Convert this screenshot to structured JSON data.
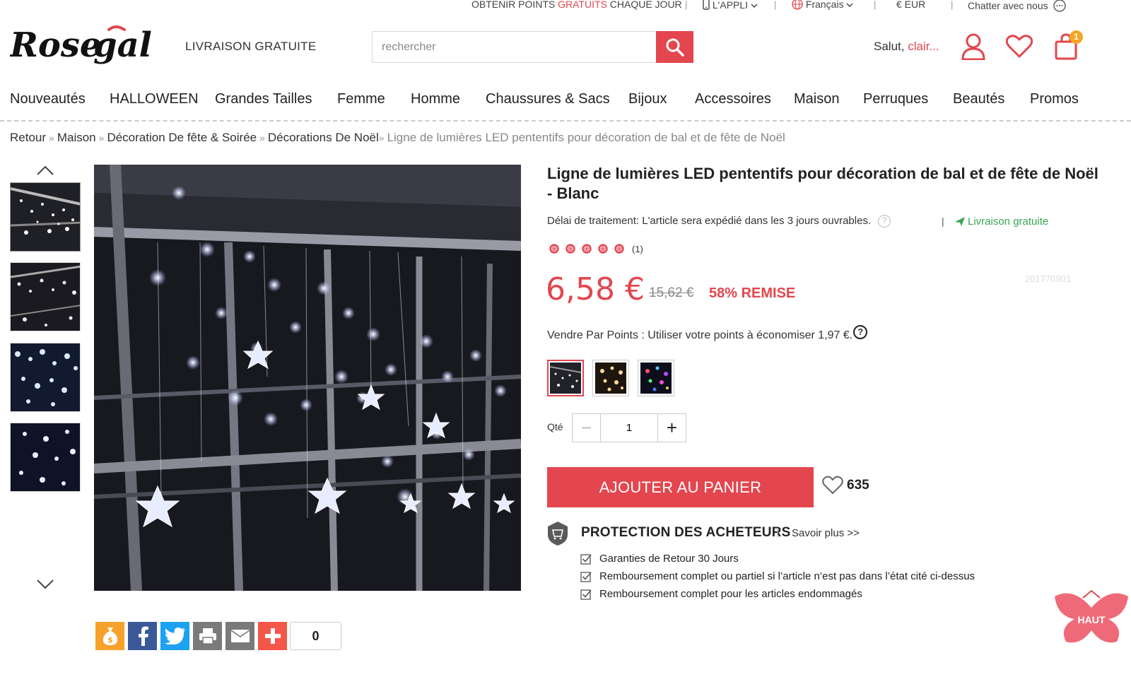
{
  "topbar": {
    "points_pre": "OBTENIR POINTS ",
    "points_red": "GRATUITS",
    "points_post": " CHAQUE JOUR",
    "app": "L'APPLI",
    "language": "Français",
    "currency": "€ EUR",
    "chat": "Chatter avec nous"
  },
  "header": {
    "logo_text": "Rosegal",
    "free_shipping": "LIVRAISON GRATUITE",
    "search_placeholder": "rechercher",
    "greeting": "Salut, ",
    "username": "clair...",
    "cart_count": "1"
  },
  "nav": {
    "items": [
      "Nouveautés",
      "HALLOWEEN",
      "Grandes Tailles",
      "Femme",
      "Homme",
      "Chaussures & Sacs",
      "Bijoux",
      "Accessoires",
      "Maison",
      "Perruques",
      "Beautés",
      "Promos"
    ]
  },
  "breadcrumb": {
    "items": [
      "Retour",
      "Maison",
      "Décoration De fête & Soirée",
      "Décorations De Noël"
    ],
    "separator": "»",
    "current": "Ligne de lumières LED pententifs pour décoration de bal et de fête de Noël"
  },
  "product": {
    "title": "Ligne de lumières LED pententifs pour décoration de bal et de fête de Noël - Blanc",
    "processing": "Délai de traitement: L'article sera expédié dans les 3 jours ouvrables.",
    "help_glyph": "?",
    "free_shipping": "Livraison gratuite",
    "rating": 5,
    "review_count": "(1)",
    "sku": "201770901",
    "price": "6,58 €",
    "old_price": "15,62 €",
    "discount": "58% REMISE",
    "points_text": "Vendre Par Points : Utiliser votre points à économiser 1,97 €.",
    "qty_label": "Qté",
    "qty_value": "1",
    "add_to_cart": "AJOUTER AU PANIER",
    "favorites": "635"
  },
  "protection": {
    "title": "PROTECTION DES ACHETEURS",
    "more": "Savoir plus >>",
    "items": [
      "Garanties de Retour 30 Jours",
      "Remboursement complet ou partiel si l’article n’est pas dans l’état cité ci-dessus",
      "Remboursement complet pour les articles endommagés"
    ]
  },
  "share": {
    "count": "0"
  },
  "back_to_top": "HAUT",
  "colors": {
    "accent": "#e3464e",
    "green": "#3aa655",
    "badge": "#f5a623"
  }
}
